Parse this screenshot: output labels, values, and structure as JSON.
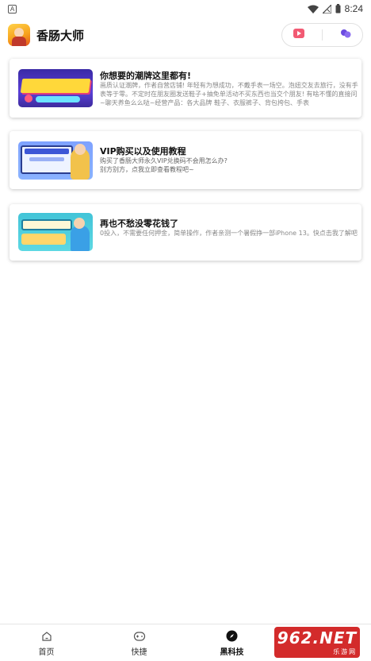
{
  "status_bar": {
    "left_glyph": "A",
    "time": "8:24",
    "icons": [
      "wifi-icon",
      "signal-icon",
      "battery-icon"
    ]
  },
  "header": {
    "app_name": "香肠大师",
    "actions": [
      "video-icon",
      "more-icon"
    ]
  },
  "cards": [
    {
      "title": "你想要的潮牌这里都有!",
      "description": "画质认证潮牌，作者自营店铺! 年轻有为想成功，不戴手表一场空。泡妞交友去旅行，没有手表等于零。不定时在朋友圈发送鞋子+抽免单活动不买东西也当交个朋友! 有啥不懂的直接问~聊天养鱼么么哒~经营产品：各大品牌 鞋子、衣服裤子、背包挎包、手表"
    },
    {
      "title": "VIP购买以及使用教程",
      "description": "购买了香肠大师永久VIP兑换码不会用怎么办?\n别方别方，点我立即查看教程吧~"
    },
    {
      "title": "再也不愁没零花钱了",
      "description": "0投入，不需要任何押金，简单操作，作者亲测一个暑假挣一部iPhone 13。快点击我了解吧"
    }
  ],
  "bottom_nav": {
    "items": [
      {
        "label": "首页",
        "icon": "home-icon"
      },
      {
        "label": "快捷",
        "icon": "gamepad-icon"
      },
      {
        "label": "黑科技",
        "icon": "compass-icon",
        "active": true
      }
    ]
  },
  "watermark": {
    "main": "962.NET",
    "sub": "乐游网"
  }
}
